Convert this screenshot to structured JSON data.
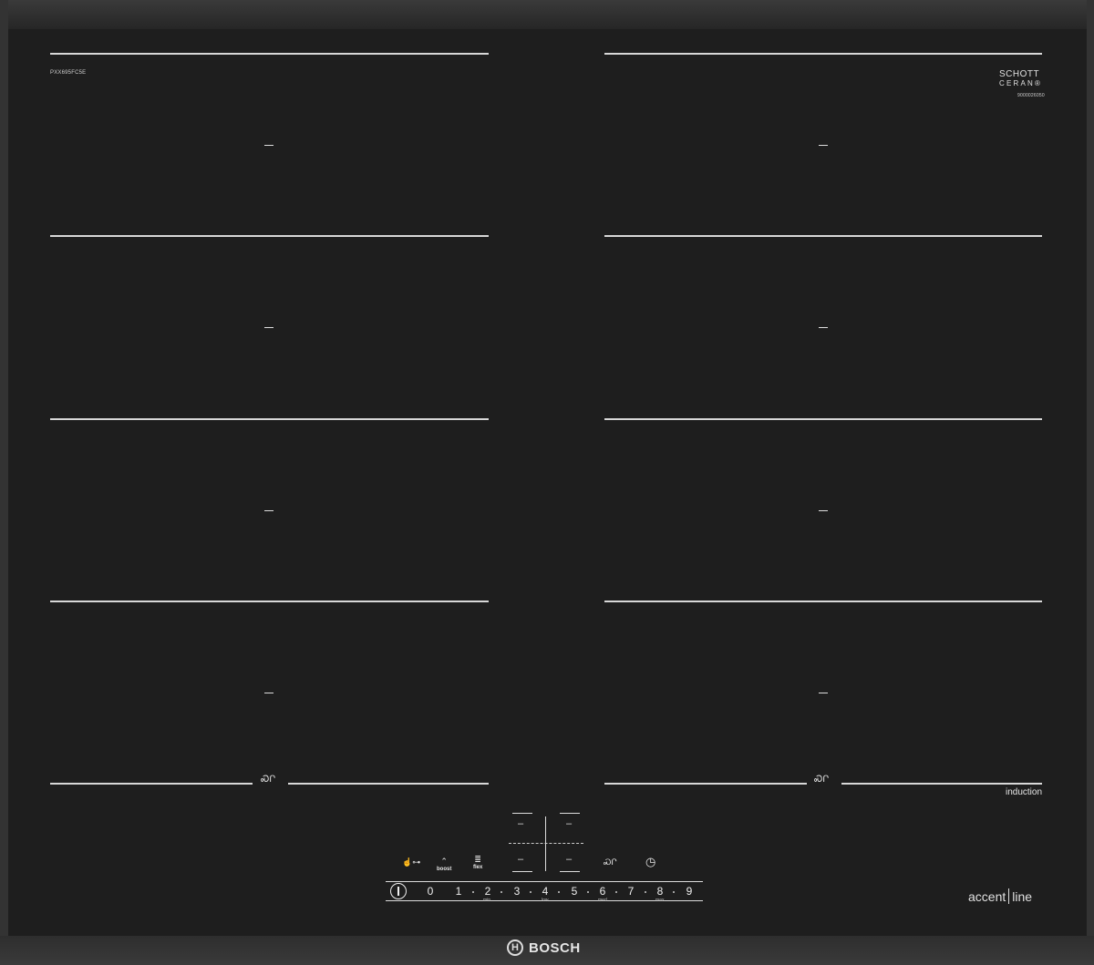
{
  "model_code": "PXX695FC5E",
  "glass_brand": {
    "line1": "SCHOTT",
    "line2": "CERAN®",
    "serial": "9000026050"
  },
  "zone_sign": "induction",
  "zone_icon_glyph": "ᏍՐ",
  "controls": {
    "lock_glyph": "☝⊶",
    "boost_glyph": "⌃",
    "boost_label": "boost",
    "flex_glyph": "≣",
    "flex_label": "flex",
    "move_glyph": "ᏍՐ",
    "timer_glyph": "◷",
    "slider_numbers": [
      "0",
      "1",
      "2",
      "3",
      "4",
      "5",
      "6",
      "7",
      "8",
      "9"
    ],
    "slider_sublabels": [
      "min",
      "low",
      "med",
      "max"
    ],
    "display_segments": [
      "–",
      "–",
      "–",
      "–"
    ]
  },
  "product_line": {
    "part1": "accent",
    "part2": "line"
  },
  "brand": "BOSCH"
}
